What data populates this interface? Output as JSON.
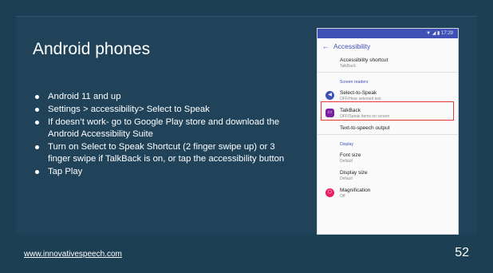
{
  "slide": {
    "title": "Android phones",
    "bullets": [
      "Android 11 and up",
      "Settings > accessibility> Select to Speak",
      "If doesn’t work- go to Google Play store and download the Android Accessibility Suite",
      "Turn on Select to Speak Shortcut (2 finger swipe up) or 3 finger swipe if TalkBack is on, or tap the accessibility button",
      "Tap Play"
    ],
    "footer_link": "www.innovativespeech.com",
    "page_number": "52"
  },
  "phone": {
    "status_time": "▼ ◢ ▮ 17:29",
    "appbar_title": "Accessibility",
    "items": {
      "shortcut_title": "Accessibility shortcut",
      "shortcut_sub": "TalkBack",
      "section_screen_readers": "Screen readers",
      "sts_title": "Select-to-Speak",
      "sts_sub": "OFF/Hear selected text",
      "talkback_title": "TalkBack",
      "talkback_sub": "OFF/Speak items on screen",
      "tts_title": "Text-to-speech output",
      "section_display": "Display",
      "font_title": "Font size",
      "font_sub": "Default",
      "display_title": "Display size",
      "display_sub": "Default",
      "mag_title": "Magnification",
      "mag_sub": "Off"
    }
  },
  "colors": {
    "background": "#1d3f54",
    "accent": "#3f51b5",
    "highlight": "#e53935"
  },
  "icons": {
    "back": "arrow-back-icon",
    "select_to_speak": "speaker-icon",
    "talkback": "talkback-icon",
    "magnification": "magnification-icon"
  }
}
